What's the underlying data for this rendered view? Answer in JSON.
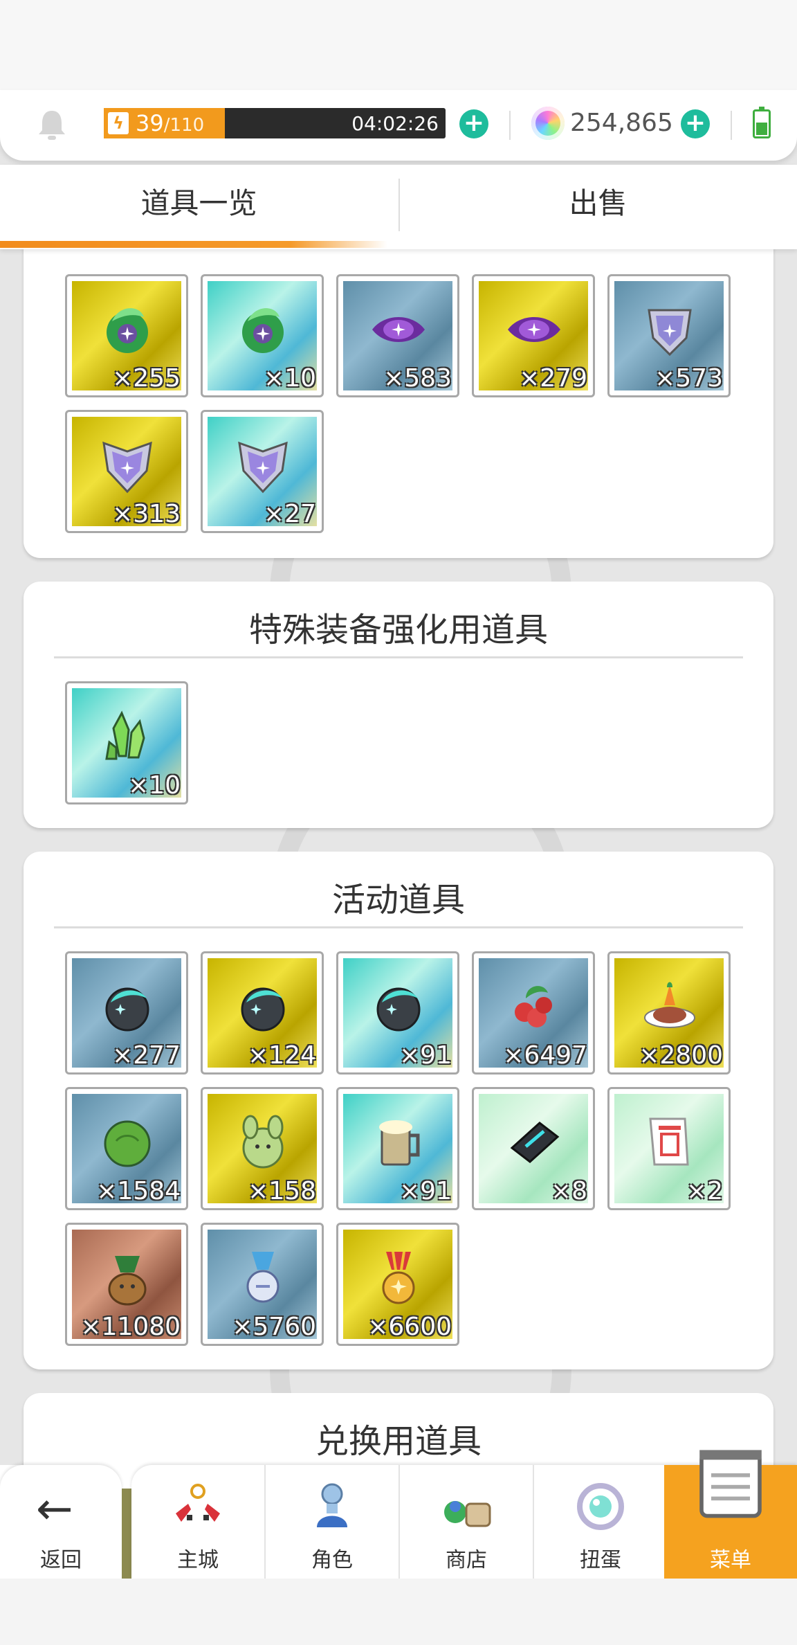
{
  "status": {
    "stamina_current": "39",
    "stamina_max": "/110",
    "stamina_fraction": 0.3545,
    "timer": "04:02:26",
    "gems": "254,865"
  },
  "tabs": [
    {
      "label": "道具一览",
      "active": true
    },
    {
      "label": "出售",
      "active": false
    }
  ],
  "sections": {
    "top_partial": {
      "items": [
        {
          "icon": "green-leaf-gem-icon",
          "bg": "gold",
          "count": "×255"
        },
        {
          "icon": "green-leaf-gem-icon",
          "bg": "teal",
          "count": "×10"
        },
        {
          "icon": "purple-eye-gem-icon",
          "bg": "blue",
          "count": "×583"
        },
        {
          "icon": "purple-eye-gem-icon",
          "bg": "gold",
          "count": "×279"
        },
        {
          "icon": "silver-shield-icon",
          "bg": "blue",
          "count": "×573"
        },
        {
          "icon": "star-shield-icon",
          "bg": "gold",
          "count": "×313"
        },
        {
          "icon": "star-shield-icon",
          "bg": "teal",
          "count": "×27"
        }
      ]
    },
    "special_enhance": {
      "title": "特殊装备强化用道具",
      "items": [
        {
          "icon": "green-crystal-icon",
          "bg": "teal",
          "count": "×10"
        }
      ]
    },
    "event_items": {
      "title": "活动道具",
      "items": [
        {
          "icon": "dark-orb-icon",
          "bg": "blue",
          "count": "×277"
        },
        {
          "icon": "dark-orb-icon",
          "bg": "gold",
          "count": "×124"
        },
        {
          "icon": "dark-orb-icon",
          "bg": "teal",
          "count": "×91"
        },
        {
          "icon": "red-berries-icon",
          "bg": "blue",
          "count": "×6497"
        },
        {
          "icon": "carrot-dish-icon",
          "bg": "gold",
          "count": "×2800"
        },
        {
          "icon": "green-cabbage-icon",
          "bg": "blue",
          "count": "×1584"
        },
        {
          "icon": "green-sprout-creature-icon",
          "bg": "gold",
          "count": "×158"
        },
        {
          "icon": "beer-mug-icon",
          "bg": "teal",
          "count": "×91"
        },
        {
          "icon": "dark-ticket-icon",
          "bg": "mint",
          "count": "×8"
        },
        {
          "icon": "red-scroll-icon",
          "bg": "mint",
          "count": "×2"
        },
        {
          "icon": "potato-sprout-icon",
          "bg": "rust",
          "count": "×11080"
        },
        {
          "icon": "blue-medal-icon",
          "bg": "blue",
          "count": "×5760"
        },
        {
          "icon": "red-medal-icon",
          "bg": "gold",
          "count": "×6600"
        }
      ]
    },
    "exchange_items": {
      "title": "兑换用道具"
    }
  },
  "nav": {
    "back": "返回",
    "items": [
      {
        "label": "主城",
        "icon": "castle-icon"
      },
      {
        "label": "角色",
        "icon": "character-icon"
      },
      {
        "label": "商店",
        "icon": "shop-icon"
      },
      {
        "label": "扭蛋",
        "icon": "gacha-icon"
      },
      {
        "label": "菜单",
        "icon": "menu-icon",
        "active": true
      }
    ]
  },
  "colors": {
    "accent_orange": "#f5a21f",
    "teal_plus": "#1ebc9c"
  }
}
